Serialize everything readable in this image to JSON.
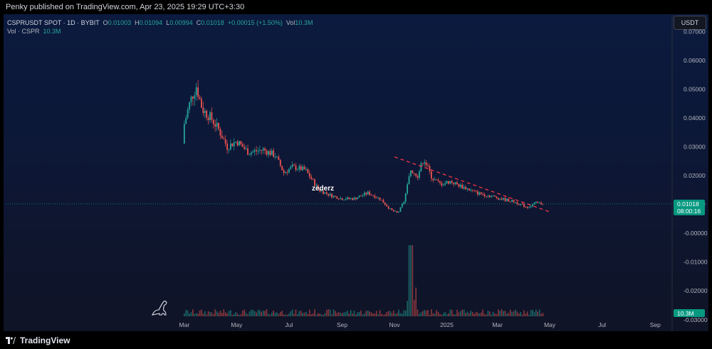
{
  "header": {
    "published": "Penky published on TradingView.com, Apr 23, 2025 19:29 UTC+3:30"
  },
  "legend": {
    "symbol": "CSPRUSDT SPOT · 1D · BYBIT",
    "o_label": "O",
    "o_value": "0.01003",
    "h_label": "H",
    "h_value": "0.01094",
    "l_label": "L",
    "l_value": "0.00994",
    "c_label": "C",
    "c_value": "0.01018",
    "change": "+0.00015 (+1.50%)",
    "vol_label": "Vol",
    "vol_value": "10.3M",
    "vol_line_label": "Vol · CSPR",
    "vol_line_value": "10.3M"
  },
  "currency_button": "USDT",
  "watermark": "zederz",
  "footer": {
    "brand": "TradingView"
  },
  "colors": {
    "up": "#26a69a",
    "down": "#ef5350",
    "trendline": "#f23645",
    "price_tag": "#089981"
  },
  "chart_data": {
    "type": "candlestick",
    "symbol": "CSPRUSDT",
    "interval": "1D",
    "exchange": "BYBIT",
    "ylim": [
      -0.034,
      0.076
    ],
    "y_ticks": [
      "0.07000",
      "0.06000",
      "0.05000",
      "0.04000",
      "0.03000",
      "0.02000",
      "0.01000",
      "-0.00000",
      "-0.01000",
      "-0.02000",
      "-0.03000"
    ],
    "x_ticks": [
      "Mar",
      "May",
      "Jul",
      "Sep",
      "Nov",
      "2025",
      "Mar",
      "May",
      "Jul",
      "Sep"
    ],
    "last_price_label": "0.01018",
    "countdown": "08:00:16",
    "volume_label": "10.3M",
    "price_path": [
      {
        "date": "2024-03-01",
        "close": 0.038
      },
      {
        "date": "2024-03-08",
        "close": 0.046
      },
      {
        "date": "2024-03-15",
        "close": 0.051
      },
      {
        "date": "2024-03-22",
        "close": 0.043
      },
      {
        "date": "2024-04-01",
        "close": 0.04
      },
      {
        "date": "2024-04-10",
        "close": 0.036
      },
      {
        "date": "2024-04-20",
        "close": 0.03
      },
      {
        "date": "2024-05-01",
        "close": 0.032
      },
      {
        "date": "2024-05-15",
        "close": 0.028
      },
      {
        "date": "2024-06-01",
        "close": 0.029
      },
      {
        "date": "2024-06-15",
        "close": 0.027
      },
      {
        "date": "2024-06-25",
        "close": 0.021
      },
      {
        "date": "2024-07-05",
        "close": 0.023
      },
      {
        "date": "2024-07-20",
        "close": 0.022
      },
      {
        "date": "2024-08-05",
        "close": 0.015
      },
      {
        "date": "2024-08-20",
        "close": 0.013
      },
      {
        "date": "2024-09-01",
        "close": 0.012
      },
      {
        "date": "2024-09-15",
        "close": 0.012
      },
      {
        "date": "2024-10-01",
        "close": 0.014
      },
      {
        "date": "2024-10-15",
        "close": 0.012
      },
      {
        "date": "2024-10-28",
        "close": 0.008
      },
      {
        "date": "2024-11-05",
        "close": 0.007
      },
      {
        "date": "2024-11-12",
        "close": 0.011
      },
      {
        "date": "2024-11-20",
        "close": 0.022
      },
      {
        "date": "2024-11-28",
        "close": 0.02
      },
      {
        "date": "2024-12-05",
        "close": 0.026
      },
      {
        "date": "2024-12-15",
        "close": 0.019
      },
      {
        "date": "2024-12-25",
        "close": 0.017
      },
      {
        "date": "2025-01-05",
        "close": 0.018
      },
      {
        "date": "2025-01-20",
        "close": 0.016
      },
      {
        "date": "2025-02-05",
        "close": 0.014
      },
      {
        "date": "2025-02-20",
        "close": 0.013
      },
      {
        "date": "2025-03-05",
        "close": 0.012
      },
      {
        "date": "2025-03-20",
        "close": 0.011
      },
      {
        "date": "2025-04-05",
        "close": 0.009
      },
      {
        "date": "2025-04-15",
        "close": 0.0105
      },
      {
        "date": "2025-04-23",
        "close": 0.01018
      }
    ],
    "trendline": [
      {
        "date": "2024-11-01",
        "value": 0.0265
      },
      {
        "date": "2025-05-03",
        "value": 0.0072
      }
    ],
    "annotations": [
      "zederz"
    ]
  }
}
